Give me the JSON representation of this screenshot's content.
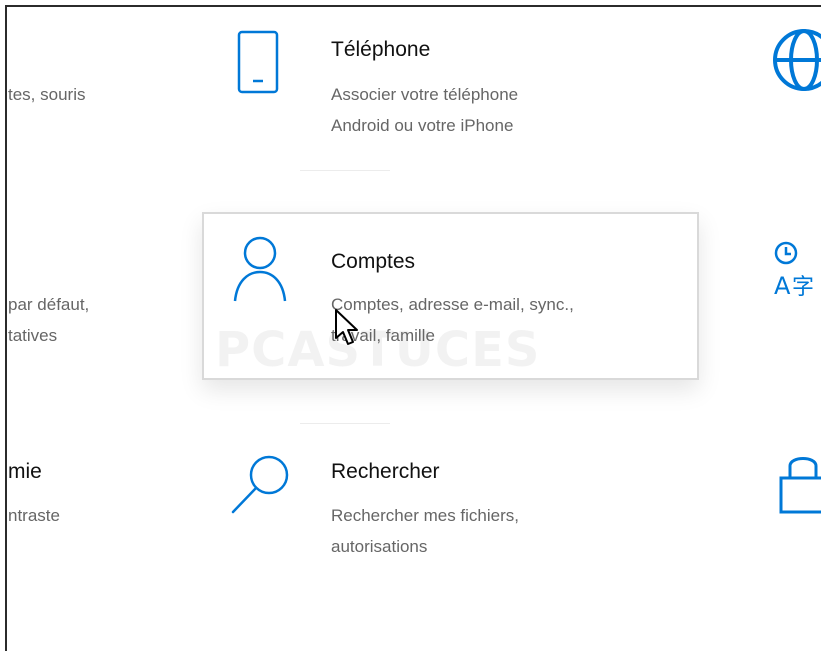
{
  "colors": {
    "accent": "#0078d7",
    "title_text": "#111111",
    "desc_text": "#666666",
    "tile_border": "#d9d9d9"
  },
  "left_column": {
    "row1_desc": "tes, souris",
    "row2_desc_line1": "par défaut,",
    "row2_desc_line2": "tatives",
    "row3_title": "mie",
    "row3_desc": "ntraste"
  },
  "items": [
    {
      "icon": "phone-icon",
      "title": "Téléphone",
      "desc_line1": "Associer votre téléphone",
      "desc_line2": "Android ou votre iPhone"
    },
    {
      "icon": "person-icon",
      "title": "Comptes",
      "desc_line1": "Comptes, adresse e-mail, sync.,",
      "desc_line2": "travail, famille"
    },
    {
      "icon": "search-icon",
      "title": "Rechercher",
      "desc_line1": "Rechercher mes fichiers,",
      "desc_line2": "autorisations"
    }
  ],
  "right_column": {
    "icons": [
      "globe-icon",
      "language-icon",
      "lock-icon"
    ]
  },
  "watermark": {
    "text": "PC",
    "text_small": "ASTUCES"
  }
}
